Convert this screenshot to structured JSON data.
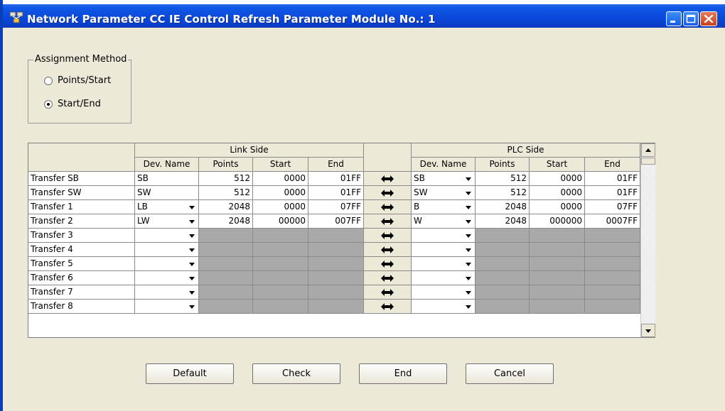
{
  "window": {
    "title": "Network Parameter  CC IE Control Refresh Parameter Module No.: 1"
  },
  "assignment": {
    "group_label": "Assignment Method",
    "options": [
      {
        "label": "Points/Start",
        "selected": false
      },
      {
        "label": "Start/End",
        "selected": true
      }
    ]
  },
  "table": {
    "link_side_label": "Link Side",
    "plc_side_label": "PLC Side",
    "columns": {
      "dev_name": "Dev. Name",
      "points": "Points",
      "start": "Start",
      "end": "End"
    },
    "arrow_icon": "bidirectional-arrow-icon",
    "rows": [
      {
        "label": "Transfer SB",
        "link": {
          "dev": "SB",
          "points": "512",
          "start": "0000",
          "end": "01FF",
          "dropdown": false
        },
        "plc": {
          "dev": "SB",
          "points": "512",
          "start": "0000",
          "end": "01FF"
        }
      },
      {
        "label": "Transfer SW",
        "link": {
          "dev": "SW",
          "points": "512",
          "start": "0000",
          "end": "01FF",
          "dropdown": false
        },
        "plc": {
          "dev": "SW",
          "points": "512",
          "start": "0000",
          "end": "01FF"
        }
      },
      {
        "label": "Transfer 1",
        "link": {
          "dev": "LB",
          "points": "2048",
          "start": "0000",
          "end": "07FF",
          "dropdown": true
        },
        "plc": {
          "dev": "B",
          "points": "2048",
          "start": "0000",
          "end": "07FF"
        }
      },
      {
        "label": "Transfer 2",
        "link": {
          "dev": "LW",
          "points": "2048",
          "start": "00000",
          "end": "007FF",
          "dropdown": true
        },
        "plc": {
          "dev": "W",
          "points": "2048",
          "start": "000000",
          "end": "0007FF"
        }
      },
      {
        "label": "Transfer 3",
        "link": {
          "dev": "",
          "points": "",
          "start": "",
          "end": "",
          "dropdown": true
        },
        "plc": {
          "dev": "",
          "points": "",
          "start": "",
          "end": ""
        }
      },
      {
        "label": "Transfer 4",
        "link": {
          "dev": "",
          "points": "",
          "start": "",
          "end": "",
          "dropdown": true
        },
        "plc": {
          "dev": "",
          "points": "",
          "start": "",
          "end": ""
        }
      },
      {
        "label": "Transfer 5",
        "link": {
          "dev": "",
          "points": "",
          "start": "",
          "end": "",
          "dropdown": true
        },
        "plc": {
          "dev": "",
          "points": "",
          "start": "",
          "end": ""
        }
      },
      {
        "label": "Transfer 6",
        "link": {
          "dev": "",
          "points": "",
          "start": "",
          "end": "",
          "dropdown": true
        },
        "plc": {
          "dev": "",
          "points": "",
          "start": "",
          "end": ""
        }
      },
      {
        "label": "Transfer 7",
        "link": {
          "dev": "",
          "points": "",
          "start": "",
          "end": "",
          "dropdown": true
        },
        "plc": {
          "dev": "",
          "points": "",
          "start": "",
          "end": ""
        }
      },
      {
        "label": "Transfer 8",
        "link": {
          "dev": "",
          "points": "",
          "start": "",
          "end": "",
          "dropdown": true
        },
        "plc": {
          "dev": "",
          "points": "",
          "start": "",
          "end": ""
        }
      }
    ]
  },
  "buttons": {
    "default": "Default",
    "check": "Check",
    "end": "End",
    "cancel": "Cancel"
  },
  "colors": {
    "titlebar": "#0a45d6",
    "dialog_bg": "#ece9d8",
    "disabled_cell": "#a9a9a9"
  }
}
